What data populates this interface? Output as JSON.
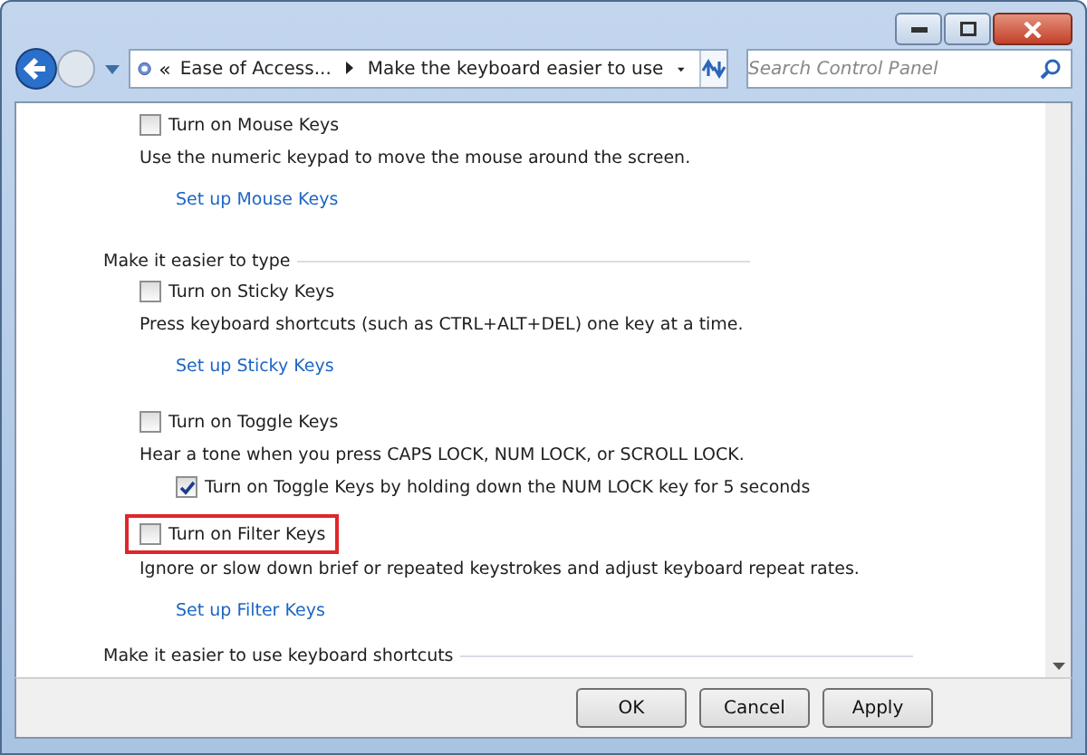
{
  "address_bar": {
    "overflow": "«",
    "crumbs": [
      "Ease of Access...",
      "Make the keyboard easier to use"
    ]
  },
  "search": {
    "placeholder": "Search Control Panel"
  },
  "content": [
    {
      "kind": "checkbox",
      "label": "Turn on Mouse Keys",
      "checked": false,
      "highlighted": false
    },
    {
      "kind": "description",
      "text": "Use the numeric keypad to move the mouse around the screen."
    },
    {
      "kind": "link",
      "text": "Set up Mouse Keys"
    },
    {
      "kind": "heading",
      "text": "Make it easier to type"
    },
    {
      "kind": "checkbox",
      "label": "Turn on Sticky Keys",
      "checked": false,
      "highlighted": false
    },
    {
      "kind": "description",
      "text": "Press keyboard shortcuts (such as CTRL+ALT+DEL) one key at a time."
    },
    {
      "kind": "link",
      "text": "Set up Sticky Keys"
    },
    {
      "kind": "checkbox",
      "label": "Turn on Toggle Keys",
      "checked": false,
      "highlighted": false
    },
    {
      "kind": "description",
      "text": "Hear a tone when you press CAPS LOCK, NUM LOCK, or SCROLL LOCK."
    },
    {
      "kind": "subcheckbox",
      "label": "Turn on Toggle Keys by holding down the NUM LOCK key for 5 seconds",
      "checked": true,
      "highlighted": false
    },
    {
      "kind": "checkbox",
      "label": "Turn on Filter Keys",
      "checked": false,
      "highlighted": true
    },
    {
      "kind": "description",
      "text": "Ignore or slow down brief or repeated keystrokes and adjust keyboard repeat rates."
    },
    {
      "kind": "link",
      "text": "Set up Filter Keys"
    },
    {
      "kind": "heading",
      "text": "Make it easier to use keyboard shortcuts"
    }
  ],
  "buttons": [
    "OK",
    "Cancel",
    "Apply"
  ]
}
